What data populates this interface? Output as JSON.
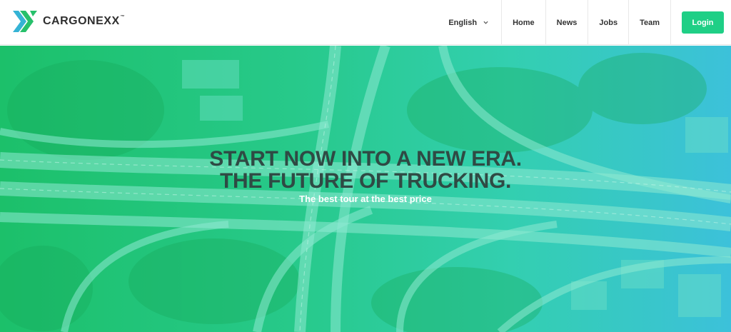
{
  "brand": {
    "name": "CARGONEXX",
    "trademark": "™"
  },
  "nav": {
    "language": "English",
    "items": [
      "Home",
      "News",
      "Jobs",
      "Team"
    ],
    "login": "Login"
  },
  "hero": {
    "title_line1": "START NOW INTO A NEW ERA.",
    "title_line2": "THE FUTURE OF TRUCKING.",
    "subtitle": "The best tour at the best price"
  },
  "colors": {
    "accent": "#1fcf86",
    "logo_green": "#27c06b",
    "logo_blue": "#35b3d5"
  },
  "icons": [
    "logo-icon",
    "chevron-down-icon"
  ]
}
